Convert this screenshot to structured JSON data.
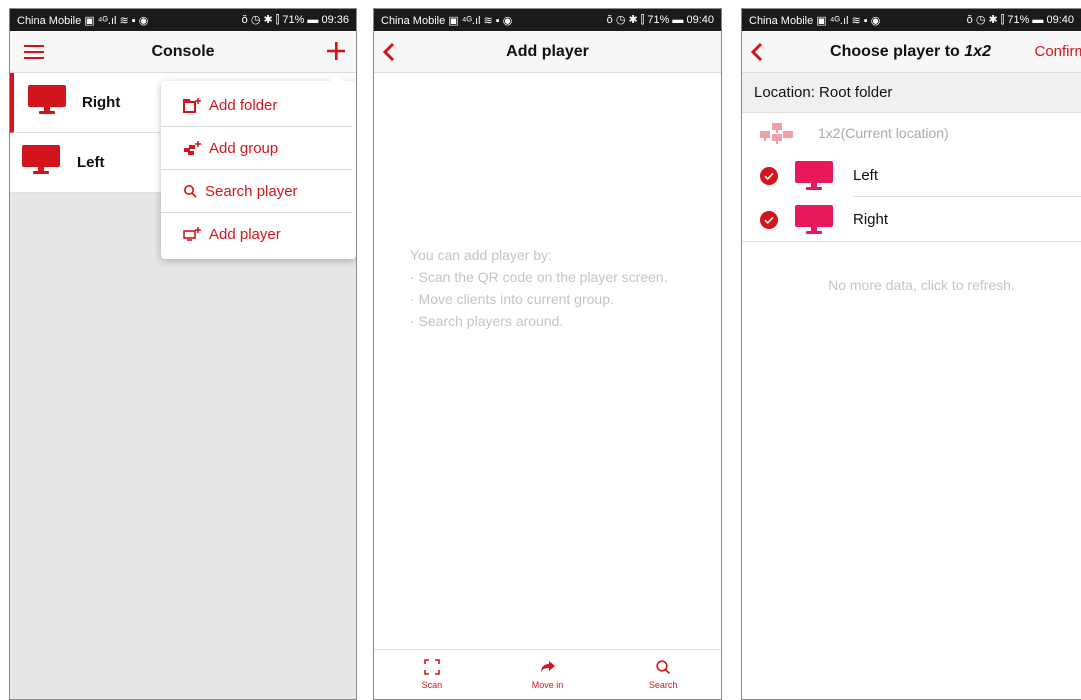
{
  "colors": {
    "accent": "#d4141c",
    "monitor": "#e8185a",
    "hint": "#c4c4c4"
  },
  "panel1": {
    "status": {
      "carrier": "China Mobile ▣ ⁴ᴳ.ıl ≋ ▪ ◉",
      "right": "ŏ ◷ ✱ ⫿ 71% ▬ 09:36"
    },
    "nav": {
      "title": "Console",
      "menu_icon": "hamburger-icon",
      "add_icon": "plus-icon"
    },
    "players": [
      {
        "label": "Right",
        "selected": true
      },
      {
        "label": "Left",
        "selected": false
      }
    ],
    "menu": [
      {
        "label": "Add folder",
        "icon": "add-folder-icon"
      },
      {
        "label": "Add group",
        "icon": "add-group-icon"
      },
      {
        "label": "Search player",
        "icon": "search-icon"
      },
      {
        "label": "Add player",
        "icon": "add-player-icon"
      }
    ]
  },
  "panel2": {
    "status": {
      "carrier": "China Mobile ▣ ⁴ᴳ.ıl ≋ ▪ ◉",
      "right": "ŏ ◷ ✱ ⫿ 71% ▬ 09:40"
    },
    "nav": {
      "title": "Add player"
    },
    "hint": [
      "You can add player by:",
      "· Scan the QR code on the player screen.",
      "· Move clients into current group.",
      "· Search players around."
    ],
    "tabs": [
      {
        "label": "Scan",
        "icon": "scan-icon"
      },
      {
        "label": "Move in",
        "icon": "share-arrow-icon"
      },
      {
        "label": "Search",
        "icon": "search-icon"
      }
    ]
  },
  "panel3": {
    "status": {
      "carrier": "China Mobile ▣ ⁴ᴳ.ıl ≋ ▪ ◉",
      "right": "ŏ ◷ ✱ ⫿ 71% ▬ 09:40"
    },
    "nav": {
      "title_prefix": "Choose player to ",
      "title_group": "1x2",
      "confirm": "Confirm"
    },
    "location": "Location: Root folder",
    "group": "1x2(Current location)",
    "players": [
      {
        "label": "Left",
        "checked": true
      },
      {
        "label": "Right",
        "checked": true
      }
    ],
    "footer": "No more data, click to refresh."
  }
}
